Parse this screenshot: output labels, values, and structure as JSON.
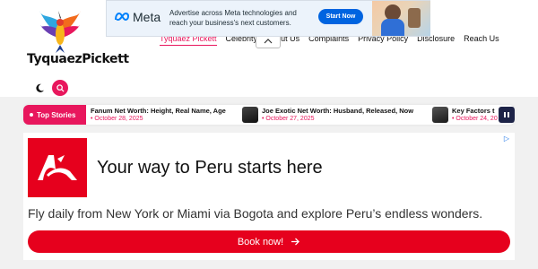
{
  "site": {
    "logo_text": "TyquaezPickett"
  },
  "nav": {
    "items": [
      {
        "label": "Tyquaez Pickett",
        "active": true
      },
      {
        "label": "Celebrity"
      },
      {
        "label": "About Us"
      },
      {
        "label": "Complaints"
      },
      {
        "label": "Privacy Policy"
      },
      {
        "label": "Disclosure"
      },
      {
        "label": "Reach Us"
      }
    ]
  },
  "meta_ad": {
    "brand": "Meta",
    "line1": "Advertise across Meta technologies and",
    "line2": "reach your business's next customers.",
    "cta": "Start Now"
  },
  "stories": {
    "label": "Top Stories",
    "items": [
      {
        "title": "Fanum Net Worth: Height, Real Name, Age",
        "date": "October 28, 2025"
      },
      {
        "title": "Joe Exotic Net Worth: Husband, Released, Now",
        "date": "October 27, 2025"
      },
      {
        "title": "Key Factors t",
        "date": "October 24, 20"
      }
    ]
  },
  "ad": {
    "headline": "Your way to Peru starts here",
    "body": "Fly daily from New York or Miami via Bogota and explore Peru’s endless wonders.",
    "cta": "Book now!"
  },
  "colors": {
    "accent": "#e8175d",
    "ad_red": "#e6001d",
    "meta_blue": "#0064e0",
    "pause_bg": "#1d2347"
  }
}
